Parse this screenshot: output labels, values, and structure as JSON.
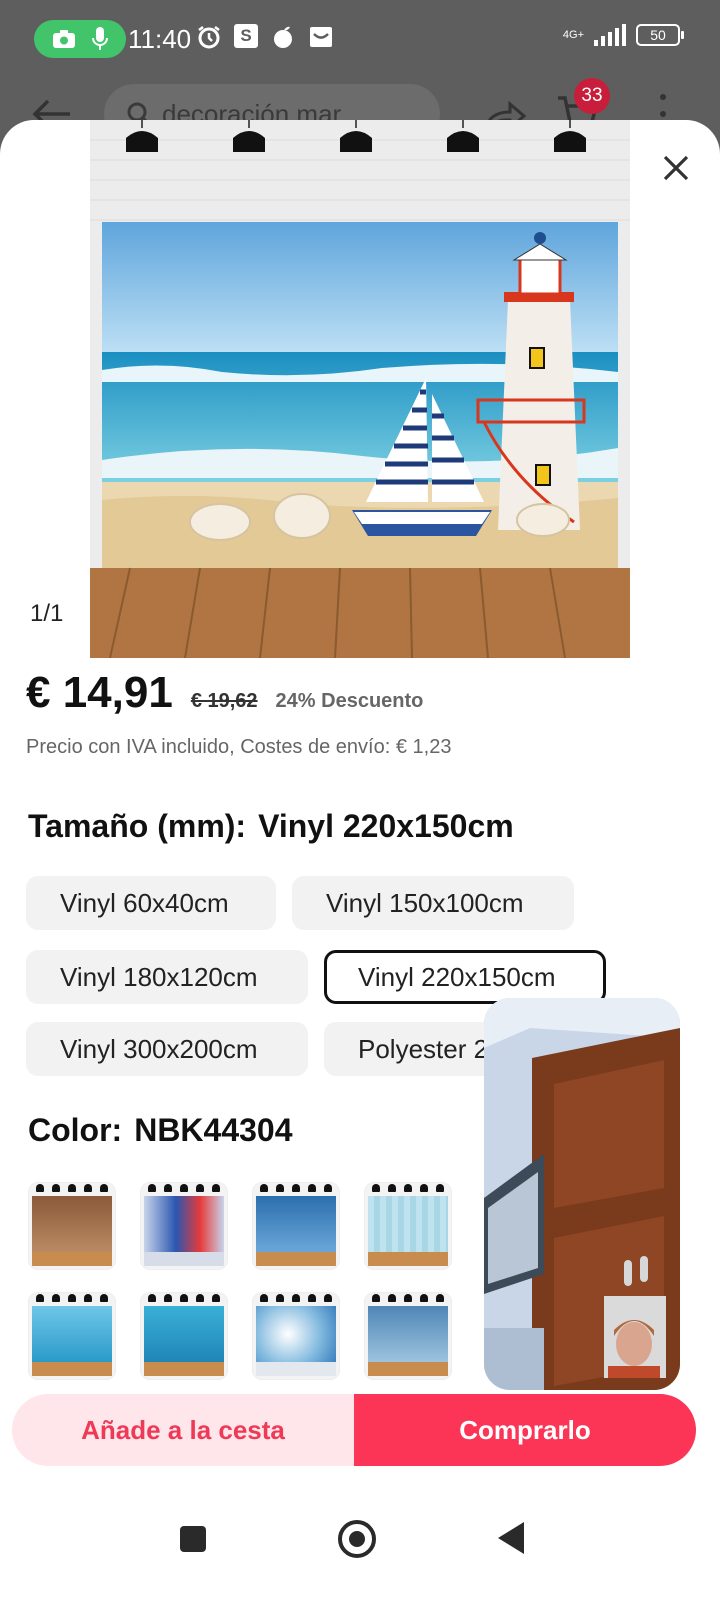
{
  "status_bar": {
    "time": "11:40",
    "network": "4G+",
    "battery": "50",
    "icons": [
      "camera-icon",
      "microphone-icon",
      "alarm-icon",
      "s-app-icon",
      "apple-icon",
      "mail-icon"
    ]
  },
  "header": {
    "search_text": "decoración mar",
    "cart_count": "33"
  },
  "product": {
    "image_counter": "1/1",
    "price": "€ 14,91",
    "old_price": "€ 19,62",
    "discount": "24% Descuento",
    "tax_note": "Precio con IVA incluido, Costes de envío: € 1,23"
  },
  "size": {
    "label": "Tamaño (mm):",
    "selected": "Vinyl 220x150cm",
    "options": [
      "Vinyl 60x40cm",
      "Vinyl 150x100cm",
      "Vinyl 180x120cm",
      "Vinyl 220x150cm",
      "Vinyl 300x200cm",
      "Polyester 2"
    ]
  },
  "color": {
    "label": "Color:",
    "selected": "NBK44304"
  },
  "actions": {
    "add_to_cart": "Añade a la cesta",
    "buy": "Comprarlo"
  },
  "colors": {
    "accent": "#fc3556",
    "accent_light": "#ffe6ea",
    "add_text": "#ee3a56",
    "status_green": "#42c46b",
    "badge": "#c81e3c"
  }
}
